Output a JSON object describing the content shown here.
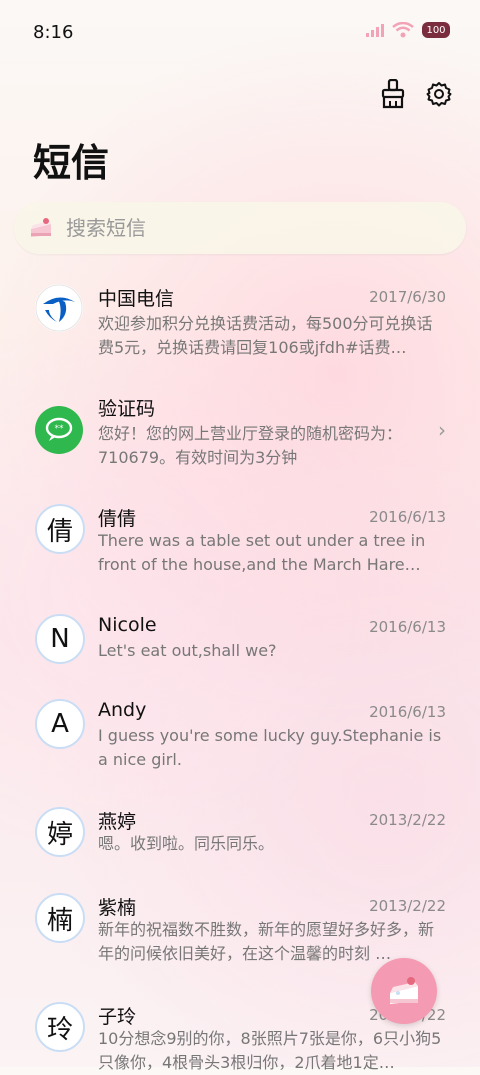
{
  "status_bar": {
    "time": "8:16",
    "battery": "100"
  },
  "header": {
    "title": "短信"
  },
  "search": {
    "placeholder": "搜索短信"
  },
  "messages": [
    {
      "avatar": "",
      "avatar_type": "telecom-logo",
      "name": "中国电信",
      "date": "2017/6/30",
      "preview": "欢迎参加积分兑换话费活动，每500分可兑换话费5元，兑换话费请回复106或jfdh#话费…"
    },
    {
      "avatar": "",
      "avatar_type": "message-icon",
      "name": "验证码",
      "date": "",
      "preview": "您好！您的网上营业厅登录的随机密码为：710679。有效时间为3分钟"
    },
    {
      "avatar": "倩",
      "name": "倩倩",
      "date": "2016/6/13",
      "preview": "There was a table set out under a tree in front of the house,and the March Hare an…"
    },
    {
      "avatar": "N",
      "name": "Nicole",
      "date": "2016/6/13",
      "preview": "Let's eat out,shall we?"
    },
    {
      "avatar": "A",
      "name": "Andy",
      "date": "2016/6/13",
      "preview": "I guess you're some lucky guy.Stephanie is a nice girl."
    },
    {
      "avatar": "婷",
      "name": "燕婷",
      "date": "2013/2/22",
      "preview": "嗯。收到啦。同乐同乐。"
    },
    {
      "avatar": "楠",
      "name": "紫楠",
      "date": "2013/2/22",
      "preview": "新年的祝福数不胜数，新年的愿望好多好多，新年的问候依旧美好，在这个温馨的时刻 …"
    },
    {
      "avatar": "玲",
      "name": "子玲",
      "date": "2013/2/22",
      "preview": "10分想念9别的你，8张照片7张是你，6只小狗5只像你，4根骨头3根归你，2爪着地1定…"
    }
  ]
}
